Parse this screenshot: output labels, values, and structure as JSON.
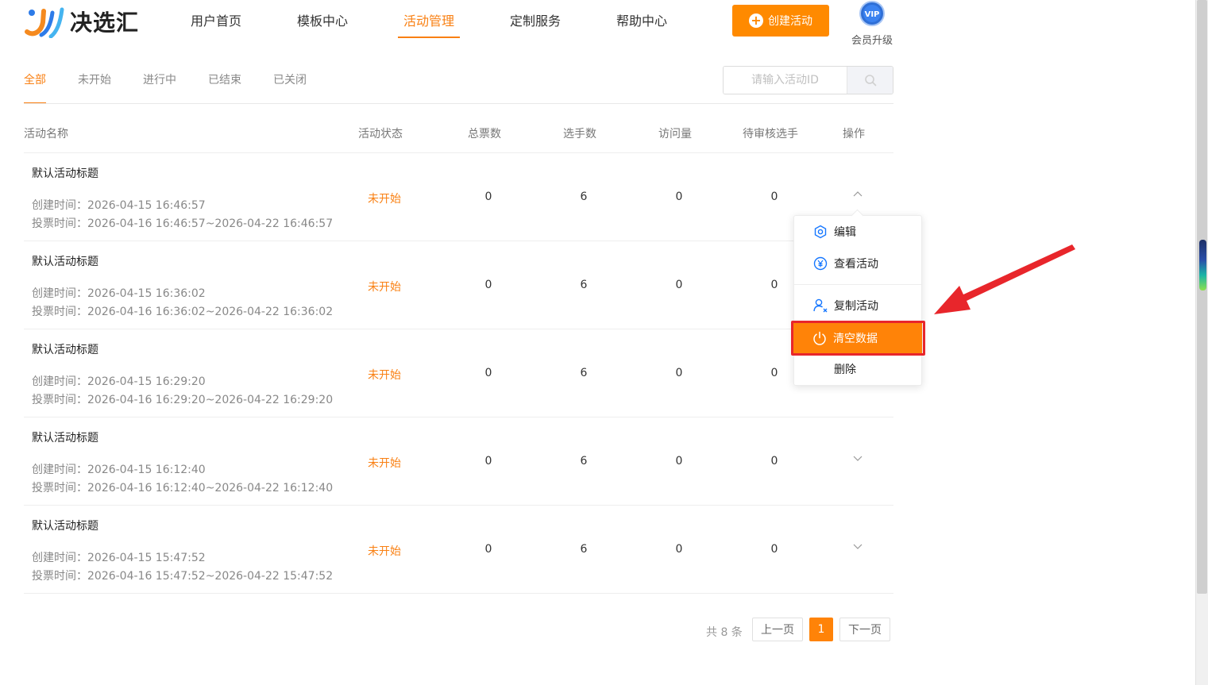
{
  "brand": {
    "name": "决选汇"
  },
  "nav": {
    "items": [
      {
        "label": "用户首页"
      },
      {
        "label": "模板中心"
      },
      {
        "label": "活动管理"
      },
      {
        "label": "定制服务"
      },
      {
        "label": "帮助中心"
      }
    ],
    "active_index": 2
  },
  "header": {
    "create_label": "创建活动",
    "vip_badge": "VIP",
    "vip_label": "会员升级"
  },
  "tabs": {
    "items": [
      {
        "label": "全部"
      },
      {
        "label": "未开始"
      },
      {
        "label": "进行中"
      },
      {
        "label": "已结束"
      },
      {
        "label": "已关闭"
      }
    ],
    "active_index": 0
  },
  "search": {
    "placeholder": "请输入活动ID",
    "value": ""
  },
  "table": {
    "headers": {
      "name": "活动名称",
      "status": "活动状态",
      "total_votes": "总票数",
      "players": "选手数",
      "visits": "访问量",
      "pending": "待审核选手",
      "actions": "操作"
    },
    "rows": [
      {
        "title": "默认活动标题",
        "created": "创建时间：2026-04-15 16:46:57",
        "vote": "投票时间：2026-04-16 16:46:57~2026-04-22 16:46:57",
        "status": "未开始",
        "total_votes": "0",
        "players": "6",
        "visits": "0",
        "pending": "0",
        "expanded": true
      },
      {
        "title": "默认活动标题",
        "created": "创建时间：2026-04-15 16:36:02",
        "vote": "投票时间：2026-04-16 16:36:02~2026-04-22 16:36:02",
        "status": "未开始",
        "total_votes": "0",
        "players": "6",
        "visits": "0",
        "pending": "0",
        "expanded": false
      },
      {
        "title": "默认活动标题",
        "created": "创建时间：2026-04-15 16:29:20",
        "vote": "投票时间：2026-04-16 16:29:20~2026-04-22 16:29:20",
        "status": "未开始",
        "total_votes": "0",
        "players": "6",
        "visits": "0",
        "pending": "0",
        "expanded": false
      },
      {
        "title": "默认活动标题",
        "created": "创建时间：2026-04-15 16:12:40",
        "vote": "投票时间：2026-04-16 16:12:40~2026-04-22 16:12:40",
        "status": "未开始",
        "total_votes": "0",
        "players": "6",
        "visits": "0",
        "pending": "0",
        "expanded": false
      },
      {
        "title": "默认活动标题",
        "created": "创建时间：2026-04-15 15:47:52",
        "vote": "投票时间：2026-04-16 15:47:52~2026-04-22 15:47:52",
        "status": "未开始",
        "total_votes": "0",
        "players": "6",
        "visits": "0",
        "pending": "0",
        "expanded": false
      }
    ]
  },
  "dropdown": {
    "items": [
      {
        "label": "编辑",
        "icon": "settings-hex-icon"
      },
      {
        "label": "查看活动",
        "icon": "yen-circle-icon"
      },
      {
        "label": "复制活动",
        "icon": "user-x-icon"
      },
      {
        "label": "清空数据",
        "icon": "power-icon",
        "highlighted": true
      },
      {
        "label": "删除",
        "icon": ""
      }
    ]
  },
  "pagination": {
    "total": "共 8 条",
    "prev": "上一页",
    "current": "1",
    "next": "下一页"
  },
  "colors": {
    "accent": "#f98013",
    "highlight": "#ff8308",
    "annotation": "#e8262b",
    "icon_blue": "#1677ff"
  }
}
